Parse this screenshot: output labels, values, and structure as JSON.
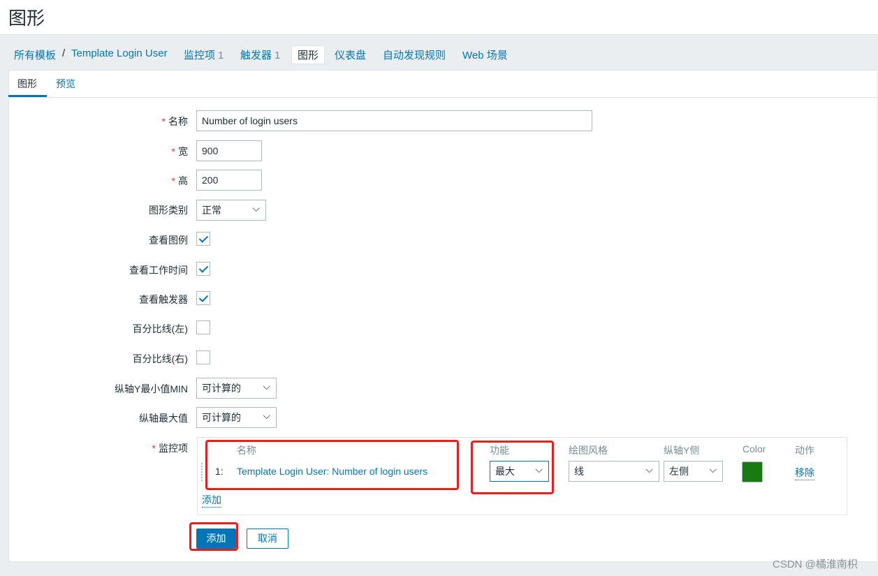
{
  "page_title": "图形",
  "breadcrumb": {
    "root": "所有模板",
    "separator": "/",
    "template": "Template Login User"
  },
  "nav": [
    {
      "label": "监控项",
      "count": "1"
    },
    {
      "label": "触发器",
      "count": "1"
    },
    {
      "label": "图形"
    },
    {
      "label": "仪表盘"
    },
    {
      "label": "自动发现规则"
    },
    {
      "label": "Web 场景"
    }
  ],
  "tabs": [
    "图形",
    "预览"
  ],
  "form": {
    "name": {
      "label": "名称",
      "value": "Number of login users"
    },
    "width": {
      "label": "宽",
      "value": "900"
    },
    "height": {
      "label": "高",
      "value": "200"
    },
    "graph_type": {
      "label": "图形类别",
      "value": "正常"
    },
    "show_legend": {
      "label": "查看图例",
      "checked": true
    },
    "show_working_time": {
      "label": "查看工作时间",
      "checked": true
    },
    "show_triggers": {
      "label": "查看触发器",
      "checked": true
    },
    "percentile_left": {
      "label": "百分比线(左)",
      "checked": false
    },
    "percentile_right": {
      "label": "百分比线(右)",
      "checked": false
    },
    "ymin": {
      "label": "纵轴Y最小值MIN",
      "value": "可计算的"
    },
    "ymax": {
      "label": "纵轴最大值",
      "value": "可计算的"
    },
    "items_label": "监控项",
    "required_mark": "*"
  },
  "items_table": {
    "headers": [
      "名称",
      "功能",
      "绘图风格",
      "纵轴Y侧",
      "Color",
      "动作"
    ],
    "rows": [
      {
        "index": "1:",
        "name": "Template Login User: Number of login users",
        "function": "最大",
        "draw_style": "线",
        "y_axis_side": "左侧",
        "color": "#1a7a12",
        "action": "移除"
      }
    ],
    "add_link": "添加"
  },
  "buttons": {
    "add": "添加",
    "cancel": "取消"
  },
  "watermark": "CSDN @橘淮南枳",
  "colors": {
    "accent": "#0275b8",
    "annotation": "#f01c1c"
  }
}
